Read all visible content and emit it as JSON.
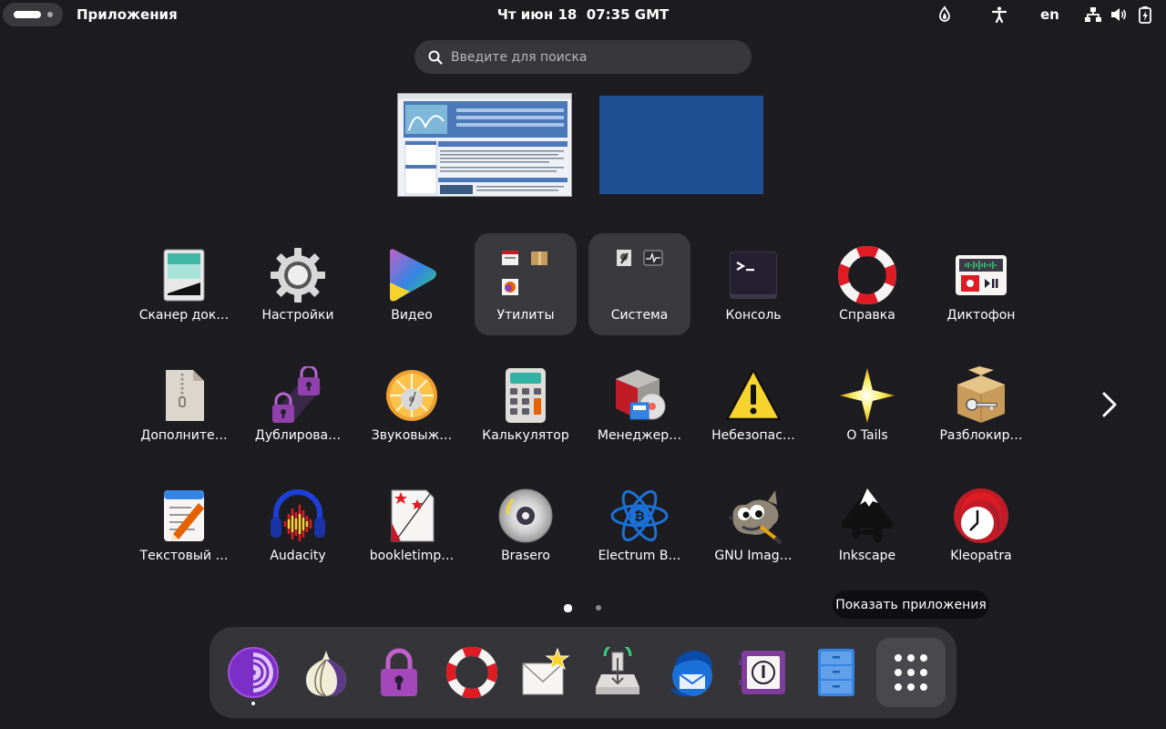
{
  "topbar": {
    "app_menu": "Приложения",
    "clock_day": "Чт июн 18",
    "clock_time": "07:35 GMT",
    "keyboard_layout": "en"
  },
  "search": {
    "placeholder": "Введите для поиска"
  },
  "apps_row1": [
    {
      "label": "Сканер док…",
      "icon": "scanner-icon"
    },
    {
      "label": "Настройки",
      "icon": "gear-icon"
    },
    {
      "label": "Видео",
      "icon": "video-player-icon"
    },
    {
      "label": "Утилиты",
      "icon": "folder-icon"
    },
    {
      "label": "Система",
      "icon": "folder-icon"
    },
    {
      "label": "Консоль",
      "icon": "terminal-icon"
    },
    {
      "label": "Справка",
      "icon": "lifebuoy-icon"
    },
    {
      "label": "Диктофон",
      "icon": "sound-recorder-icon"
    }
  ],
  "apps_row2": [
    {
      "label": "Дополните…",
      "icon": "archive-icon"
    },
    {
      "label": "Дублирова…",
      "icon": "padlock-icon"
    },
    {
      "label": "Звуковыж…",
      "icon": "disc-burner-icon"
    },
    {
      "label": "Калькулятор",
      "icon": "calculator-icon"
    },
    {
      "label": "Менеджер…",
      "icon": "package-manager-icon"
    },
    {
      "label": "Небезопас…",
      "icon": "warning-icon"
    },
    {
      "label": "О Tails",
      "icon": "star-icon"
    },
    {
      "label": "Разблокир…",
      "icon": "key-box-icon"
    }
  ],
  "apps_row3": [
    {
      "label": "Текстовый …",
      "icon": "text-editor-icon"
    },
    {
      "label": "Audacity",
      "icon": "audacity-icon"
    },
    {
      "label": "bookletimp…",
      "icon": "bookletimposer-icon"
    },
    {
      "label": "Brasero",
      "icon": "brasero-icon"
    },
    {
      "label": "Electrum B…",
      "icon": "electrum-bitcoin-icon"
    },
    {
      "label": "GNU Imag…",
      "icon": "gimp-icon"
    },
    {
      "label": "Inkscape",
      "icon": "inkscape-icon"
    },
    {
      "label": "Kleopatra",
      "icon": "kleopatra-icon"
    }
  ],
  "tooltip": "Показать приложения",
  "colors": {
    "background": "#1d1d21",
    "folder_tile": "#3a3a3e",
    "dock": "#353539"
  }
}
